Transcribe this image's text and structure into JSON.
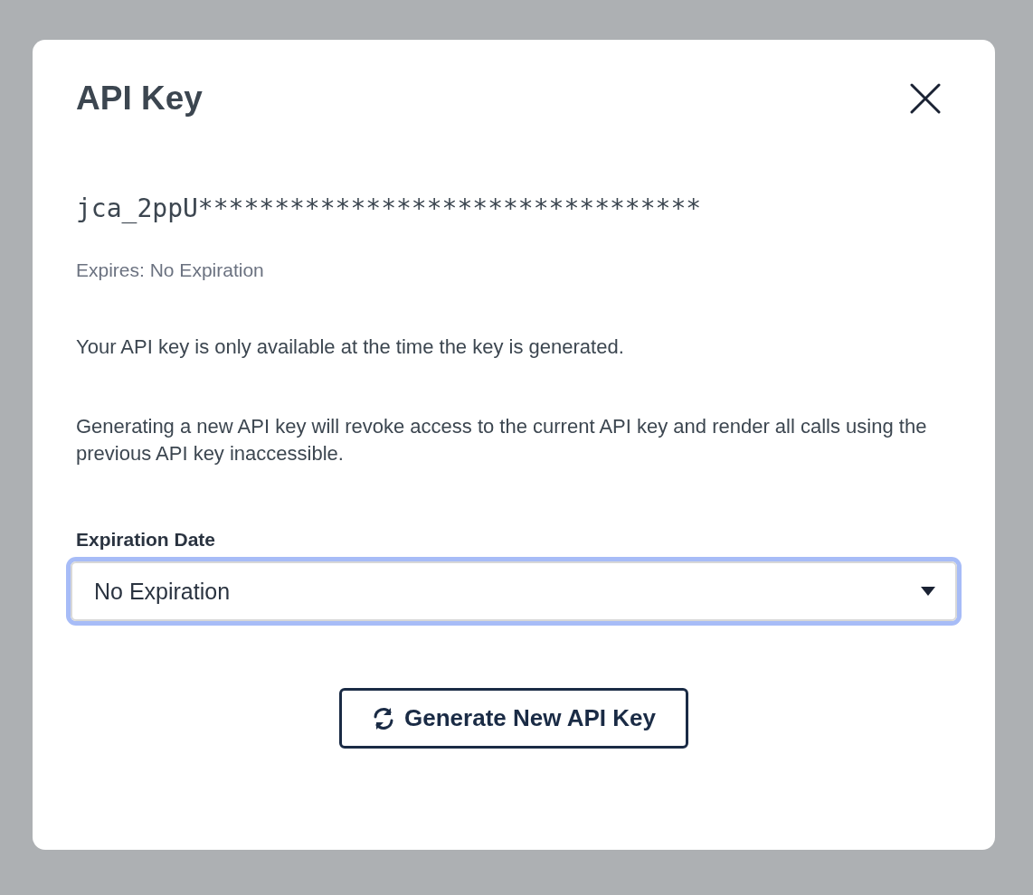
{
  "dialog": {
    "title": "API Key"
  },
  "api_key": "jca_2ppU*********************************",
  "expires": "Expires: No Expiration",
  "paragraphs": [
    "Your API key is only available at the time the key is generated.",
    "Generating a new API key will revoke access to the current API key and render all calls using the previous API key inaccessible."
  ],
  "expiration_field": {
    "label": "Expiration Date",
    "value": "No Expiration",
    "focused": true
  },
  "generate_button": {
    "label": "Generate New API Key"
  }
}
